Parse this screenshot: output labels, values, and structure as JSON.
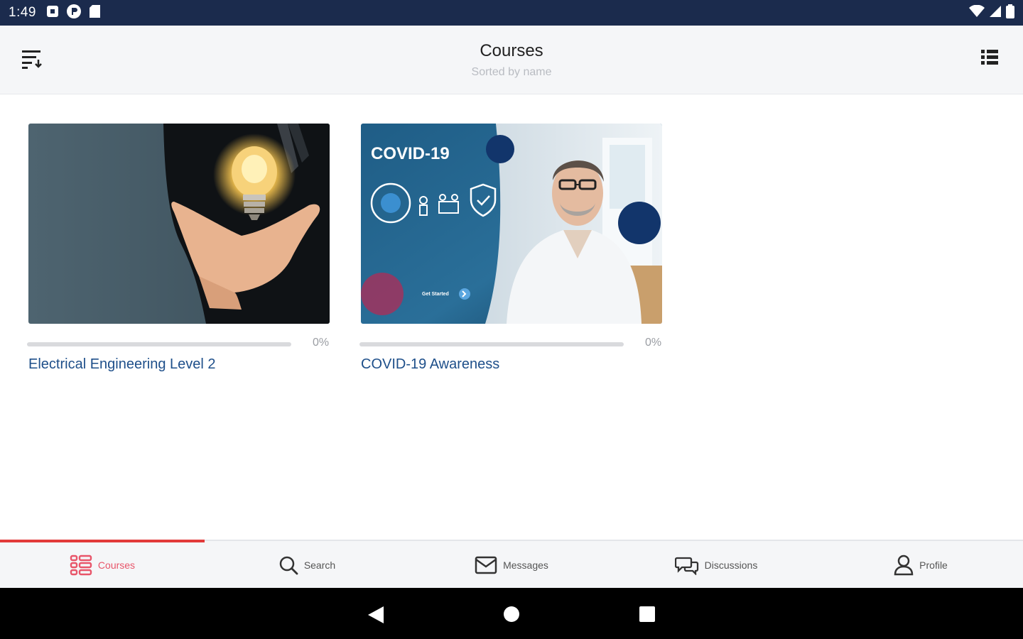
{
  "status_bar": {
    "time": "1:49",
    "icons_left": [
      "notification-icon",
      "sync-icon",
      "sd-card-icon"
    ],
    "icons_right": [
      "wifi-icon",
      "cellular-icon",
      "battery-icon"
    ]
  },
  "app_bar": {
    "title": "Courses",
    "subtitle": "Sorted by name",
    "left_icon": "sort-icon",
    "right_icon": "list-view-icon"
  },
  "courses": [
    {
      "title": "Electrical Engineering Level 2",
      "progress_percent": 0,
      "progress_label": "0%",
      "thumbnail": "lightbulb-hand-image"
    },
    {
      "title": "COVID-19 Awareness",
      "progress_percent": 0,
      "progress_label": "0%",
      "thumbnail": "covid-banner-image",
      "thumbnail_heading": "COVID-19",
      "thumbnail_button": "Get Started"
    }
  ],
  "bottom_nav": {
    "items": [
      {
        "label": "Courses",
        "icon": "courses-icon",
        "active": true
      },
      {
        "label": "Search",
        "icon": "search-icon",
        "active": false
      },
      {
        "label": "Messages",
        "icon": "mail-icon",
        "active": false
      },
      {
        "label": "Discussions",
        "icon": "chat-icon",
        "active": false
      },
      {
        "label": "Profile",
        "icon": "user-icon",
        "active": false
      }
    ]
  },
  "colors": {
    "status_bar": "#1b2b4d",
    "accent_active": "#e8556a",
    "indicator": "#e23a3a",
    "link_blue": "#1e4f8a"
  }
}
